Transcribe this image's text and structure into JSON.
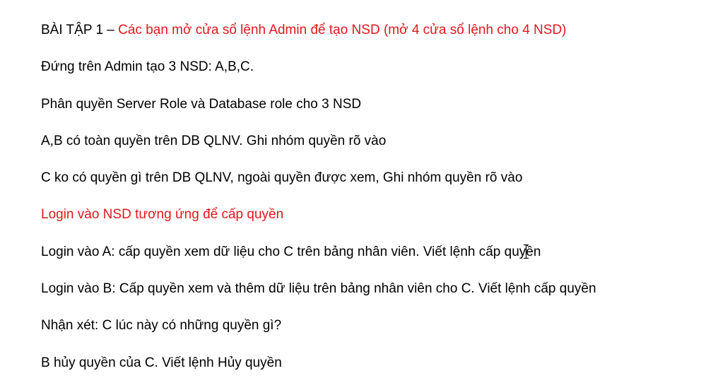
{
  "exercise": {
    "title_prefix": "BÀI TẬP 1 – ",
    "title_instruction": "Các bạn mở cửa sổ lệnh Admin để tạo NSD (mở 4 cửa sổ lệnh cho 4 NSD)",
    "lines": [
      "Đứng trên Admin tạo 3 NSD: A,B,C.",
      "Phân quyền Server Role và Database role cho 3 NSD",
      "A,B có toàn quyền trên DB QLNV.  Ghi nhóm quyền rõ vào",
      "C ko có quyền gì trên DB QLNV, ngoài quyền được xem, Ghi nhóm quyền rõ vào"
    ],
    "login_heading": "Login vào NSD tương ứng để cấp quyền",
    "login_lines": [
      "Login vào A: cấp quyền xem dữ liệu cho C trên bảng nhân viên. Viết lệnh cấp quyền",
      "Login vào B: Cấp quyền xem và thêm dữ liệu trên bảng nhân viên cho C. Viết lệnh cấp quyền",
      "Nhận xét: C lúc này có những quyền gì?",
      "B hủy quyền của C. Viết lệnh Hủy quyền"
    ]
  },
  "colors": {
    "text": "#000000",
    "highlight": "#e0191d",
    "background": "#ffffff"
  },
  "icons": {
    "cursor": "text-cursor-icon"
  }
}
